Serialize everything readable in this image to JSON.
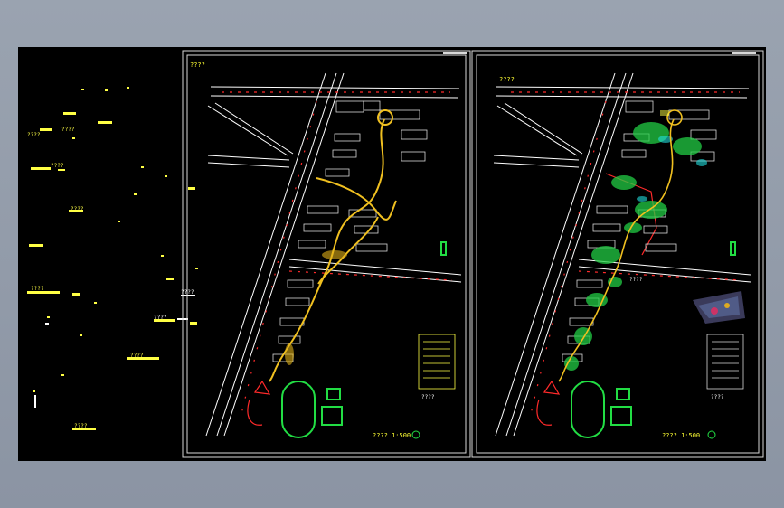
{
  "colors": {
    "background": "#8f98a6",
    "canvas": "#000000",
    "frame": "#d8d8d8",
    "road": "#ffffff",
    "accent_red": "#ff2a2a",
    "path_yellow": "#f0c020",
    "green": "#22dd44",
    "cyan": "#22dddd"
  },
  "left_panel_labels": [
    "????",
    "????",
    "????",
    "????",
    "????",
    "????",
    "????",
    "????",
    "????"
  ],
  "sheet1": {
    "corner_label": "????",
    "title": "????  1:500",
    "legend_title": "????"
  },
  "sheet2": {
    "corner_label": "????",
    "title": "????  1:500",
    "legend_title": "????",
    "callout_label": "????"
  }
}
